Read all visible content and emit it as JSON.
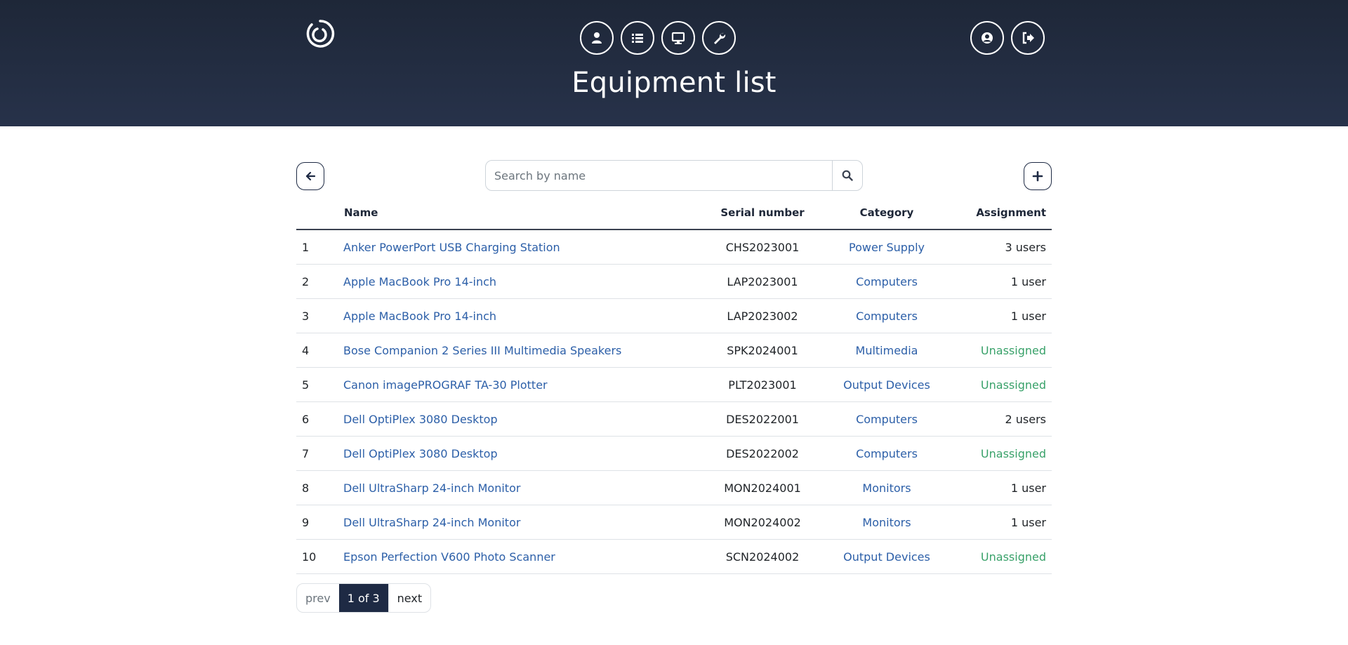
{
  "header": {
    "title": "Equipment list",
    "nav_icons": [
      "user-icon",
      "list-icon",
      "monitor-icon",
      "wrench-icon"
    ],
    "right_icons": [
      "account-circle-icon",
      "sign-out-icon"
    ]
  },
  "search": {
    "placeholder": "Search by name",
    "value": ""
  },
  "table": {
    "columns": [
      "",
      "Name",
      "Serial number",
      "Category",
      "Assignment"
    ],
    "rows": [
      {
        "idx": "1",
        "name": "Anker PowerPort USB Charging Station",
        "serial": "CHS2023001",
        "category": "Power Supply",
        "assignment": "3 users"
      },
      {
        "idx": "2",
        "name": "Apple MacBook Pro 14-inch",
        "serial": "LAP2023001",
        "category": "Computers",
        "assignment": "1 user"
      },
      {
        "idx": "3",
        "name": "Apple MacBook Pro 14-inch",
        "serial": "LAP2023002",
        "category": "Computers",
        "assignment": "1 user"
      },
      {
        "idx": "4",
        "name": "Bose Companion 2 Series III Multimedia Speakers",
        "serial": "SPK2024001",
        "category": "Multimedia",
        "assignment": "Unassigned"
      },
      {
        "idx": "5",
        "name": "Canon imagePROGRAF TA-30 Plotter",
        "serial": "PLT2023001",
        "category": "Output Devices",
        "assignment": "Unassigned"
      },
      {
        "idx": "6",
        "name": "Dell OptiPlex 3080 Desktop",
        "serial": "DES2022001",
        "category": "Computers",
        "assignment": "2 users"
      },
      {
        "idx": "7",
        "name": "Dell OptiPlex 3080 Desktop",
        "serial": "DES2022002",
        "category": "Computers",
        "assignment": "Unassigned"
      },
      {
        "idx": "8",
        "name": "Dell UltraSharp 24-inch Monitor",
        "serial": "MON2024001",
        "category": "Monitors",
        "assignment": "1 user"
      },
      {
        "idx": "9",
        "name": "Dell UltraSharp 24-inch Monitor",
        "serial": "MON2024002",
        "category": "Monitors",
        "assignment": "1 user"
      },
      {
        "idx": "10",
        "name": "Epson Perfection V600 Photo Scanner",
        "serial": "SCN2024002",
        "category": "Output Devices",
        "assignment": "Unassigned"
      }
    ]
  },
  "pagination": {
    "prev": "prev",
    "current": "1 of 3",
    "next": "next"
  },
  "colors": {
    "header_bg": "#1e2738",
    "link": "#2c5fa8",
    "unassigned": "#38a169",
    "accent": "#1e2a44"
  }
}
